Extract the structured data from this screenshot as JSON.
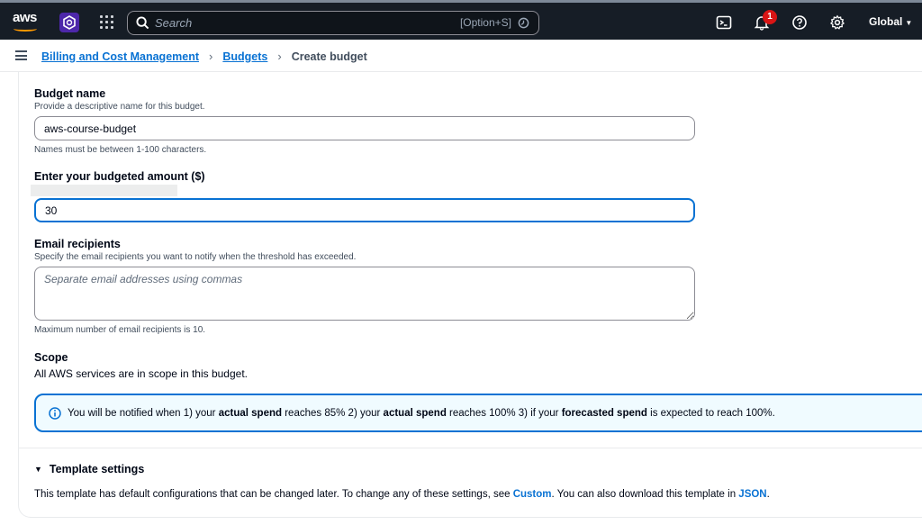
{
  "topnav": {
    "logo_text": "aws",
    "search_placeholder": "Search",
    "search_shortcut": "[Option+S]",
    "notification_count": "1",
    "region": "Global",
    "icons": [
      "cloudshell-icon",
      "bell-icon",
      "help-icon",
      "gear-icon"
    ]
  },
  "breadcrumb": {
    "items": [
      "Billing and Cost Management",
      "Budgets"
    ],
    "current": "Create budget"
  },
  "form": {
    "budget_name": {
      "label": "Budget name",
      "description": "Provide a descriptive name for this budget.",
      "value": "aws-course-budget",
      "hint": "Names must be between 1-100 characters."
    },
    "budget_amount": {
      "label": "Enter your budgeted amount ($)",
      "value": "30"
    },
    "email": {
      "label": "Email recipients",
      "description": "Specify the email recipients you want to notify when the threshold has exceeded.",
      "placeholder": "Separate email addresses using commas",
      "hint": "Maximum number of email recipients is 10."
    },
    "scope": {
      "label": "Scope",
      "text": "All AWS services are in scope in this budget."
    }
  },
  "alert": {
    "p1": "You will be notified when 1) your ",
    "b1": "actual spend",
    "p2": " reaches 85% 2) your ",
    "b2": "actual spend",
    "p3": " reaches 100% 3) if your ",
    "b3": "forecasted spend",
    "p4": " is expected to reach 100%."
  },
  "template": {
    "title": "Template settings",
    "text1": "This template has default configurations that can be changed later. To change any of these settings, see ",
    "link1": "Custom",
    "text2": ". You can also download this template in ",
    "link2": "JSON",
    "text3": "."
  },
  "colors": {
    "nav_bg": "#161d26",
    "link": "#0972d3",
    "alert_bg": "#f0fbff",
    "badge": "#d91515"
  }
}
